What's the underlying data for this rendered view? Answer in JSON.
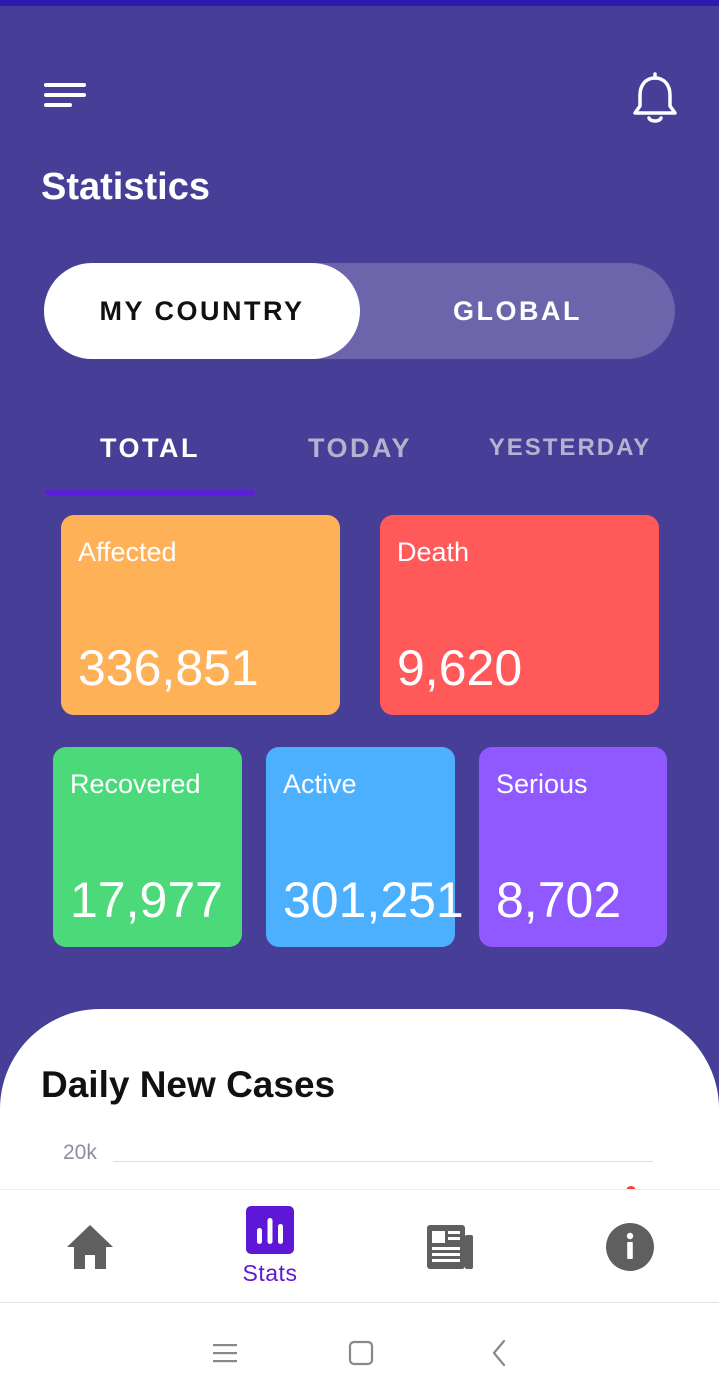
{
  "app": {
    "title": "Statistics",
    "accent_color": "#473f97",
    "top_strip_color": "#2e1ab0"
  },
  "header": {
    "menu_icon": "menu-icon",
    "notification_icon": "bell-icon"
  },
  "region_toggle": {
    "options": [
      "MY COUNTRY",
      "GLOBAL"
    ],
    "selected": "MY COUNTRY"
  },
  "period_tabs": {
    "items": [
      "TOTAL",
      "TODAY",
      "YESTERDAY"
    ],
    "selected": "TOTAL",
    "indicator_color": "#5c1ed6"
  },
  "stats": {
    "affected": {
      "label": "Affected",
      "value": "336,851",
      "color": "#ffb158"
    },
    "death": {
      "label": "Death",
      "value": "9,620",
      "color": "#ff5959"
    },
    "recovered": {
      "label": "Recovered",
      "value": "17,977",
      "color": "#4bd97a"
    },
    "active": {
      "label": "Active",
      "value": "301,251",
      "color": "#4cb0ff"
    },
    "serious": {
      "label": "Serious",
      "value": "8,702",
      "color": "#9059ff"
    }
  },
  "daily_cases": {
    "title": "Daily New Cases",
    "y_tick_top": "20k"
  },
  "bottom_nav": {
    "items": [
      {
        "icon": "home-icon",
        "label": ""
      },
      {
        "icon": "bar-chart-icon",
        "label": "Stats"
      },
      {
        "icon": "newspaper-icon",
        "label": ""
      },
      {
        "icon": "info-icon",
        "label": ""
      }
    ],
    "selected": "Stats",
    "active_color": "#5e17d6"
  },
  "system_nav": {
    "icons": [
      "recents-icon",
      "home-square-icon",
      "back-icon"
    ]
  }
}
